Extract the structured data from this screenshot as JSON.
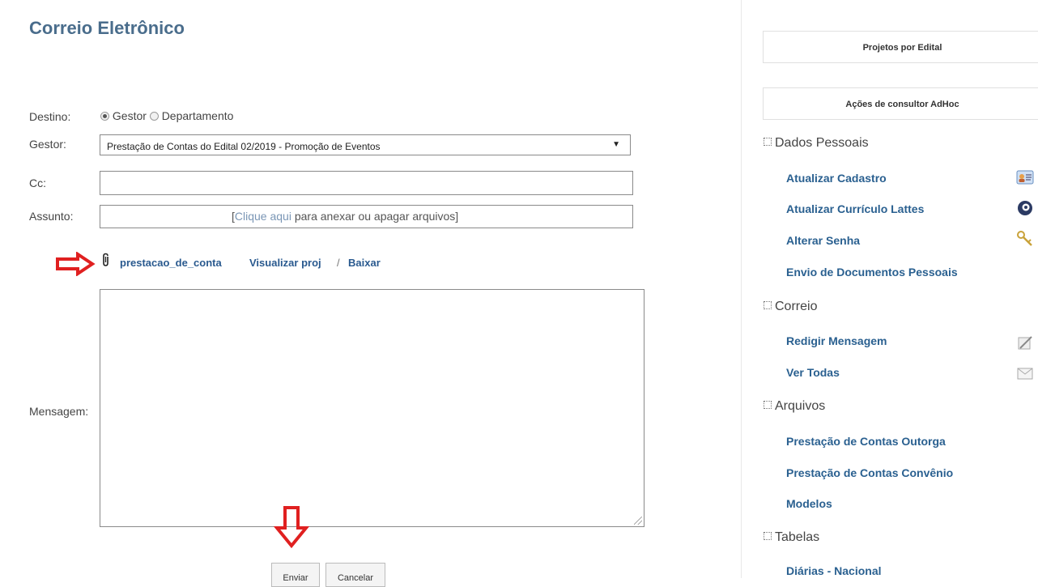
{
  "page": {
    "title": "Correio Eletrônico"
  },
  "form": {
    "destino_label": "Destino:",
    "destino_options": [
      "Gestor",
      "Departamento"
    ],
    "destino_selected": "Gestor",
    "gestor_label": "Gestor:",
    "gestor_value": "Prestação de Contas do Edital 02/2019 - Promoção de Eventos",
    "cc_label": "Cc:",
    "cc_value": "",
    "assunto_label": "Assunto:",
    "assunto_value": "",
    "attach_prefix": "[",
    "attach_link": "Clique aqui",
    "attach_suffix": " para anexar ou apagar arquivos]",
    "attachment_name": "prestacao_de_conta",
    "visualizar_label": "Visualizar proj",
    "separator": "/",
    "baixar_label": "Baixar",
    "mensagem_label": "Mensagem:",
    "mensagem_value": "",
    "enviar_label": "Enviar",
    "cancelar_label": "Cancelar"
  },
  "sidebar": {
    "box1": "Projetos por Edital",
    "box2": "Ações de consultor AdHoc",
    "sections": [
      {
        "title": "Dados Pessoais",
        "items": [
          "Atualizar Cadastro",
          "Atualizar Currículo Lattes",
          "Alterar Senha",
          "Envio de Documentos Pessoais"
        ]
      },
      {
        "title": "Correio",
        "items": [
          "Redigir Mensagem",
          "Ver Todas"
        ]
      },
      {
        "title": "Arquivos",
        "items": [
          "Prestação de Contas Outorga",
          "Prestação de Contas Convênio",
          "Modelos"
        ]
      },
      {
        "title": "Tabelas",
        "items": [
          "Diárias - Nacional"
        ]
      }
    ]
  },
  "colors": {
    "title": "#4a6d8c",
    "link": "#2a6090",
    "arrow": "#e02020"
  },
  "icons": [
    "paperclip-icon",
    "contact-card-icon",
    "lattes-icon",
    "key-icon",
    "compose-icon",
    "envelope-icon",
    "arrow-right-icon",
    "arrow-down-icon"
  ]
}
